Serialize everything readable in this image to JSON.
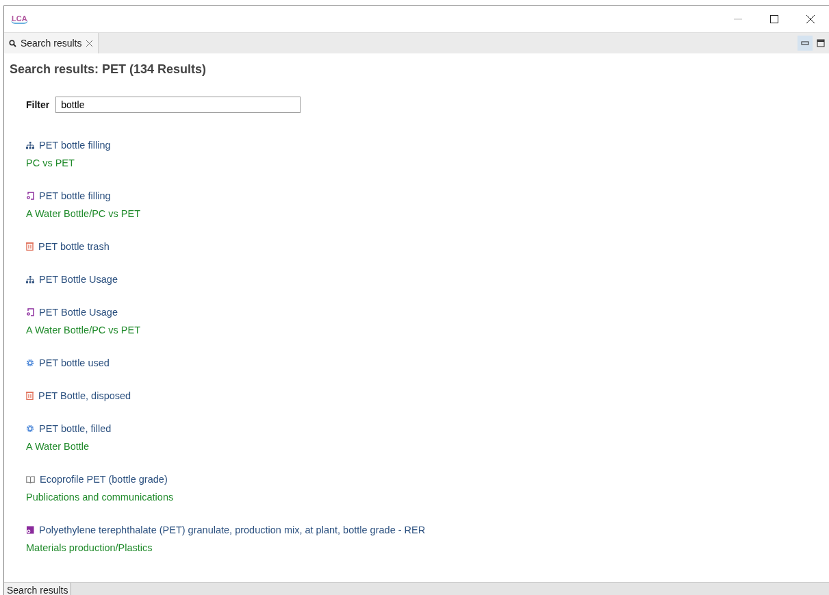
{
  "window": {
    "logo": "LCA"
  },
  "tabs": [
    {
      "label": "Search results",
      "selected": true
    }
  ],
  "heading": "Search results: PET (134 Results)",
  "filter": {
    "label": "Filter",
    "value": "bottle"
  },
  "results": [
    {
      "kind": "product_system",
      "name": "PET bottle filling",
      "category": "PC vs PET"
    },
    {
      "kind": "project",
      "name": "PET bottle filling",
      "category": "A Water Bottle/PC vs PET"
    },
    {
      "kind": "waste",
      "name": "PET bottle trash"
    },
    {
      "kind": "product_system",
      "name": "PET Bottle Usage"
    },
    {
      "kind": "project",
      "name": "PET Bottle Usage",
      "category": "A Water Bottle/PC vs PET"
    },
    {
      "kind": "flow",
      "name": "PET bottle used"
    },
    {
      "kind": "waste",
      "name": "PET Bottle, disposed"
    },
    {
      "kind": "flow",
      "name": "PET bottle, filled",
      "category": "A Water Bottle"
    },
    {
      "kind": "source",
      "name": "Ecoprofile PET (bottle grade)",
      "category": "Publications and communications"
    },
    {
      "kind": "process",
      "name": "Polyethylene terephthalate (PET) granulate, production mix, at plant, bottle grade - RER",
      "category": "Materials production/Plastics"
    }
  ],
  "bottom_tabs": [
    {
      "label": "Search results",
      "selected": true
    }
  ]
}
